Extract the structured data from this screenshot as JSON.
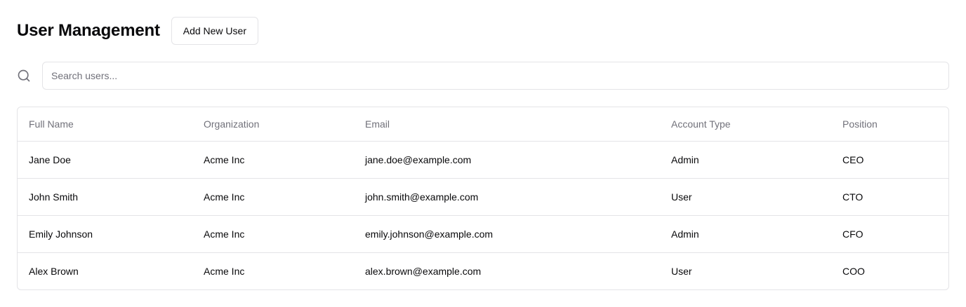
{
  "header": {
    "title": "User Management",
    "add_button_label": "Add New User"
  },
  "search": {
    "icon": "search-icon",
    "placeholder": "Search users...",
    "value": ""
  },
  "table": {
    "columns": [
      "Full Name",
      "Organization",
      "Email",
      "Account Type",
      "Position"
    ],
    "rows": [
      {
        "full_name": "Jane Doe",
        "organization": "Acme Inc",
        "email": "jane.doe@example.com",
        "account_type": "Admin",
        "position": "CEO"
      },
      {
        "full_name": "John Smith",
        "organization": "Acme Inc",
        "email": "john.smith@example.com",
        "account_type": "User",
        "position": "CTO"
      },
      {
        "full_name": "Emily Johnson",
        "organization": "Acme Inc",
        "email": "emily.johnson@example.com",
        "account_type": "Admin",
        "position": "CFO"
      },
      {
        "full_name": "Alex Brown",
        "organization": "Acme Inc",
        "email": "alex.brown@example.com",
        "account_type": "User",
        "position": "COO"
      }
    ]
  },
  "colors": {
    "text": "#09090b",
    "muted": "#71717a",
    "border": "#e4e4e7"
  }
}
